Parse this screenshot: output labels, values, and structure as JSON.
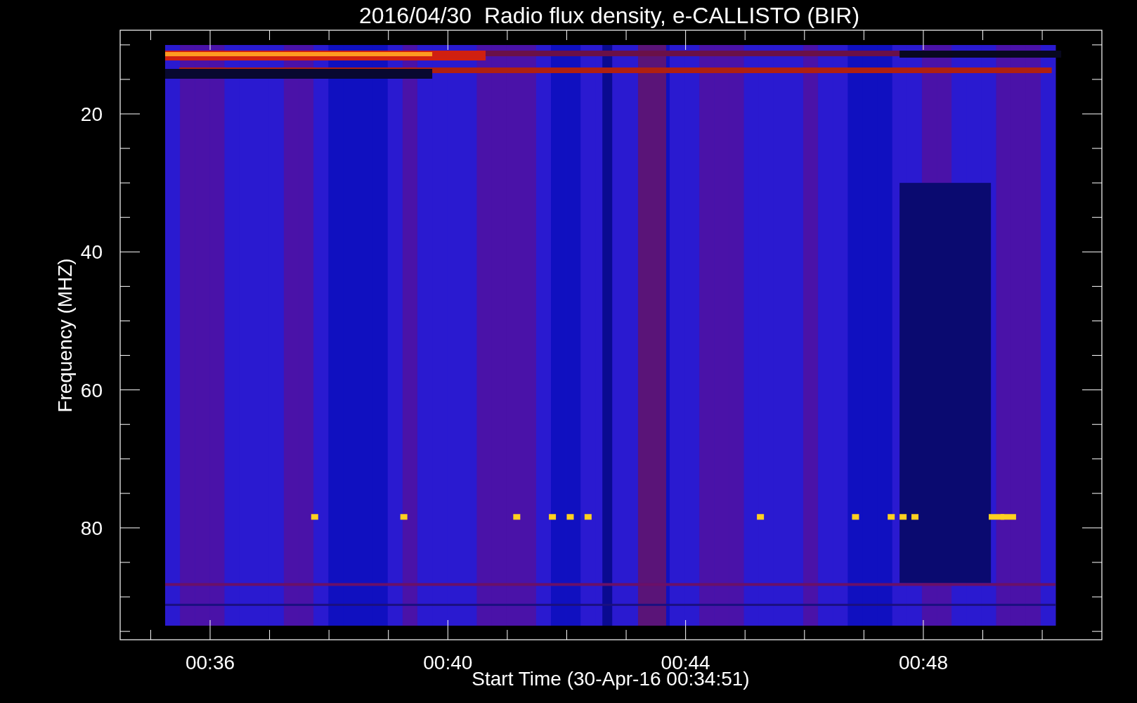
{
  "title": "2016/04/30  Radio flux density, e-CALLISTO (BIR)",
  "y_axis": {
    "label": "Frequency (MHZ)",
    "ticks": [
      "20",
      "40",
      "60",
      "80"
    ]
  },
  "x_axis": {
    "label": "Start Time (30-Apr-16 00:34:51)",
    "ticks": [
      "00:36",
      "00:40",
      "00:44",
      "00:48"
    ]
  }
}
